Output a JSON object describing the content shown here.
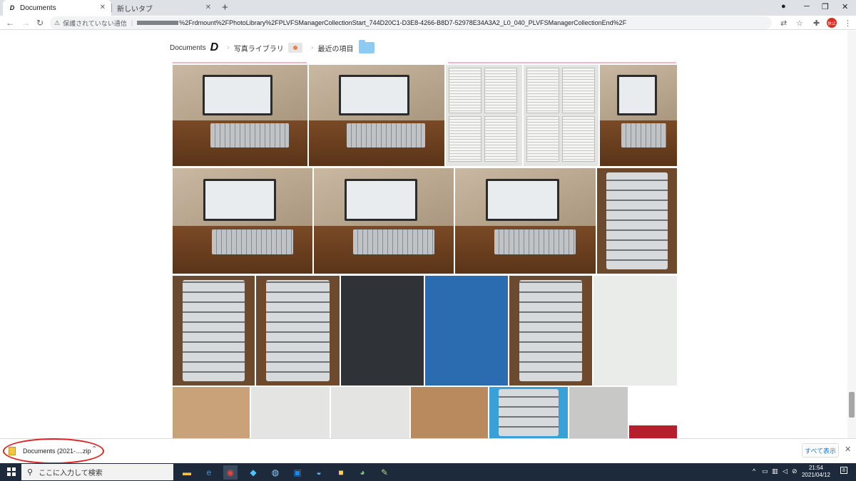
{
  "browser": {
    "tabs": [
      {
        "label": "Documents",
        "active": true
      },
      {
        "label": "新しいタブ",
        "active": false
      }
    ],
    "address": {
      "security_label": "保護されていない通信",
      "url_visible": "%2Frdmount%2FPhotoLibrary%2FPLVFSManagerCollectionStart_744D20C1-D3E8-4266-B8D7-52978E34A3A2_L0_040_PLVFSManagerCollectionEnd%2F"
    },
    "profile_badge": "休止"
  },
  "breadcrumb": {
    "items": [
      "Documents",
      "写真ライブラリ",
      "最近の項目"
    ]
  },
  "download_shelf": {
    "file_label": "Documents (2021-....zip",
    "show_all_label": "すべて表示"
  },
  "taskbar": {
    "search_placeholder": "ここに入力して検索",
    "time": "21:54",
    "date": "2021/04/12",
    "notification_count": "8"
  },
  "colors": {
    "annotation_red": "#e02020",
    "link_blue": "#1a73e8",
    "taskbar_bg": "#1c2a3c"
  },
  "photo_grid": {
    "rows": 4
  }
}
